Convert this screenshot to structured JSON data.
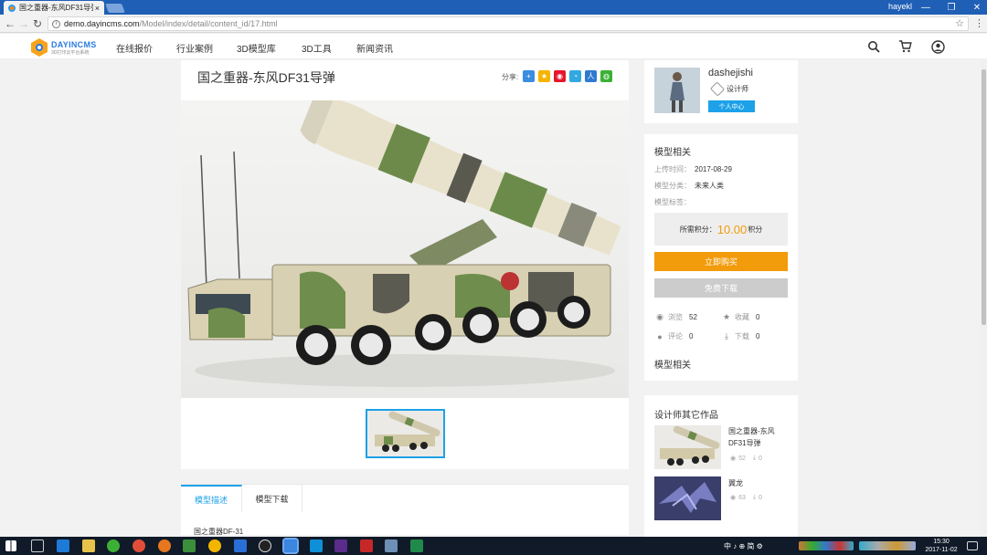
{
  "browser": {
    "tab_title": "国之重器-东风DF31导弹",
    "tab_close": "×",
    "user": "hayekl",
    "url_host": "demo.dayincms.com",
    "url_path": "/Model/index/detail/content_id/17.html",
    "minimize": "—",
    "restore": "❐",
    "close": "✕"
  },
  "site": {
    "logo_main": "DAYINCMS",
    "logo_sub": "3D打印云平台系统",
    "nav": [
      "在线报价",
      "行业案例",
      "3D模型库",
      "3D工具",
      "新闻资讯"
    ]
  },
  "product": {
    "title": "国之重器-东风DF31导弹",
    "share_label": "分享:",
    "tabs": [
      "模型描述",
      "模型下载"
    ],
    "description": "国之重器DF-31"
  },
  "designer": {
    "name": "dashejishi",
    "role": "设计师",
    "center_button": "个人中心"
  },
  "model_info": {
    "heading": "模型相关",
    "upload_label": "上传时间：",
    "upload_date": "2017-08-29",
    "category_label": "模型分类：",
    "category": "未来人类",
    "tags_label": "模型标签：",
    "price_label": "所需积分：",
    "price_value": "10.00",
    "price_unit": "积分",
    "buy_button": "立即购买",
    "download_button": "免费下载",
    "views_label": "浏览",
    "views": "52",
    "favorites_label": "收藏",
    "favorites": "0",
    "comments_label": "评论",
    "comments": "0",
    "downloads_label": "下载",
    "downloads": "0",
    "related_heading": "模型相关"
  },
  "other_works": {
    "heading": "设计师其它作品",
    "items": [
      {
        "title": "国之重器-东风DF31导弹",
        "views": "52",
        "downloads": "0"
      },
      {
        "title": "翼龙",
        "views": "63",
        "downloads": "0"
      }
    ]
  },
  "taskbar": {
    "ime": "中 ♪ ⊕ 简 ⚙",
    "time": "15:30",
    "date": "2017-11-02"
  },
  "colors": {
    "accent_blue": "#1da1e8",
    "buy_orange": "#f29b0b",
    "titlebar": "#1f5fb5"
  }
}
